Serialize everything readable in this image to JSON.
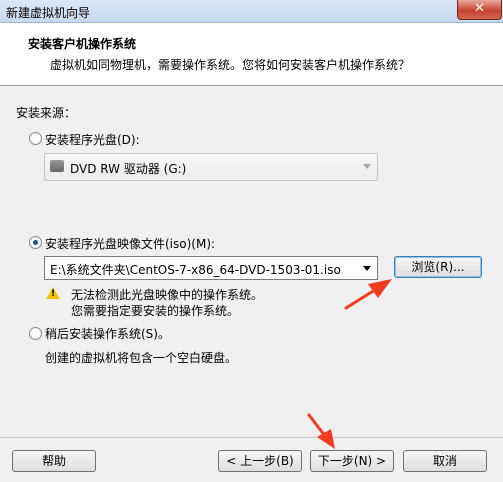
{
  "window": {
    "title": "新建虚拟机向导",
    "close_label": "✕"
  },
  "header": {
    "title": "安装客户机操作系统",
    "subtitle": "虚拟机如同物理机，需要操作系统。您将如何安装客户机操作系统？"
  },
  "source": {
    "label": "安装来源：",
    "option_disc": {
      "label": "安装程序光盘(D):",
      "selected": false
    },
    "disc_drive": {
      "value": "DVD RW 驱动器 (G:)"
    },
    "option_iso": {
      "label": "安装程序光盘映像文件(iso)(M):",
      "selected": true
    },
    "iso_path": {
      "value": "E:\\系统文件夹\\CentOS-7-x86_64-DVD-1503-01.iso"
    },
    "browse_label": "浏览(R)...",
    "warning_line1": "无法检测此光盘映像中的操作系统。",
    "warning_line2": "您需要指定要安装的操作系统。",
    "option_later": {
      "label": "稍后安装操作系统(S)。",
      "selected": false
    },
    "later_note": "创建的虚拟机将包含一个空白硬盘。"
  },
  "footer": {
    "help_label": "帮助",
    "back_label": "< 上一步(B)",
    "next_label": "下一步(N) >",
    "cancel_label": "取消"
  },
  "colors": {
    "annotation_arrow": "#f23c1f",
    "radio_dot": "#1f4e9c"
  }
}
